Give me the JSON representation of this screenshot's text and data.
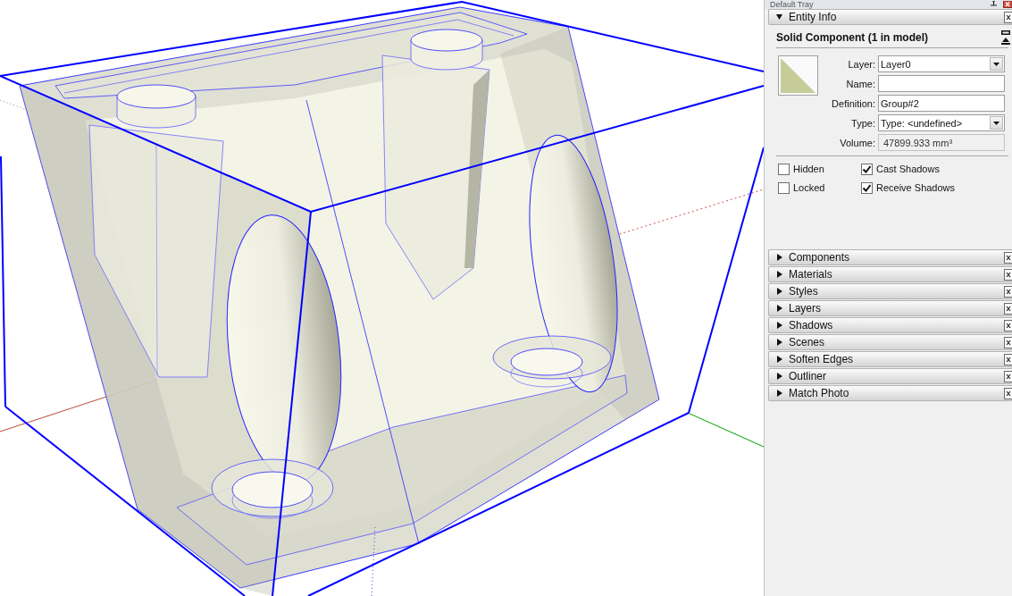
{
  "tray": {
    "title": "Default Tray"
  },
  "entity_info": {
    "title": "Entity Info",
    "expanded": true,
    "heading": "Solid Component (1 in model)",
    "fields": [
      {
        "label": "Layer:",
        "kind": "dropdown",
        "value": "Layer0"
      },
      {
        "label": "Name:",
        "kind": "text"
      },
      {
        "label": "Definition:",
        "kind": "text",
        "value": "Group#2"
      },
      {
        "label": "Type:",
        "kind": "dropdown",
        "value": "Type: <undefined>"
      },
      {
        "label": "Volume:",
        "kind": "readonly",
        "value": "47899.933 mm³"
      }
    ],
    "checkboxes": [
      {
        "label": "Hidden",
        "checked": false
      },
      {
        "label": "Cast Shadows",
        "checked": true
      },
      {
        "label": "Locked",
        "checked": false
      },
      {
        "label": "Receive Shadows",
        "checked": true
      }
    ]
  },
  "panels": [
    {
      "title": "Components",
      "expanded": false
    },
    {
      "title": "Materials",
      "expanded": false
    },
    {
      "title": "Styles",
      "expanded": false
    },
    {
      "title": "Layers",
      "expanded": false
    },
    {
      "title": "Shadows",
      "expanded": false
    },
    {
      "title": "Scenes",
      "expanded": false
    },
    {
      "title": "Soften Edges",
      "expanded": false
    },
    {
      "title": "Outliner",
      "expanded": false
    },
    {
      "title": "Match Photo",
      "expanded": false
    }
  ]
}
